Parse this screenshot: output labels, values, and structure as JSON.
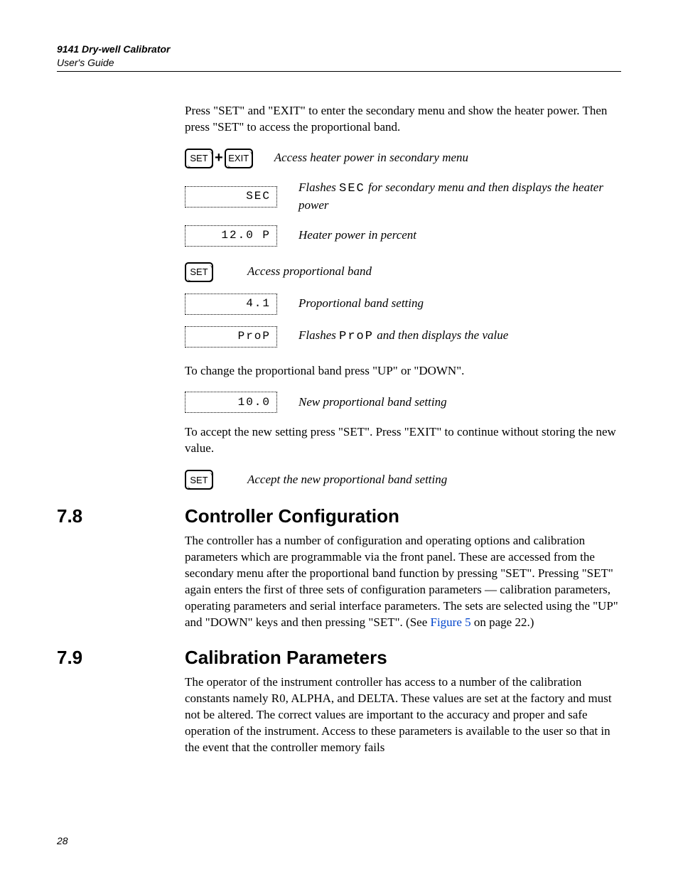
{
  "header": {
    "title": "9141 Dry-well Calibrator",
    "subtitle": "User's Guide"
  },
  "intro_para": "Press \"SET\" and \"EXIT\" to enter the secondary menu and show the heater power. Then press \"SET\" to access the proportional band.",
  "keys": {
    "set": "SET",
    "exit": "EXIT",
    "plus": "+"
  },
  "rows": {
    "r1": {
      "desc": "Access heater power in secondary menu"
    },
    "r2": {
      "disp": "SEC",
      "desc_pre": "Flashes ",
      "desc_code": "SEC",
      "desc_post": " for secondary menu and then displays the heater power"
    },
    "r3": {
      "disp": "12.0 P",
      "desc": "Heater power in percent"
    },
    "r4": {
      "desc": "Access proportional band"
    },
    "r5": {
      "disp": "4.1",
      "desc": "Proportional band setting"
    },
    "r6": {
      "disp": "ProP",
      "desc_pre": "Flashes ",
      "desc_code": "ProP",
      "desc_post": " and then displays the value"
    }
  },
  "mid_para": "To change the proportional band press \"UP\" or \"DOWN\".",
  "rows2": {
    "r7": {
      "disp": "10.0",
      "desc": "New proportional band setting"
    }
  },
  "accept_para": "To accept the new setting press \"SET\". Press \"EXIT\" to continue without storing the new value.",
  "rows3": {
    "r8": {
      "desc": "Accept the new proportional band setting"
    }
  },
  "section78": {
    "num": "7.8",
    "title": "Controller Configuration",
    "body_a": "The controller has a number of configuration and operating options and calibration parameters which are programmable via the front panel. These are accessed from the secondary menu after the proportional band function by pressing \"SET\". Pressing \"SET\" again enters the first of three sets of configuration parameters — calibration parameters, operating parameters and serial interface parameters. The sets are selected using the \"UP\" and \"DOWN\" keys and then pressing \"SET\". (See ",
    "fig_link": "Figure 5",
    "body_b": " on page 22.)"
  },
  "section79": {
    "num": "7.9",
    "title": "Calibration Parameters",
    "body": "The operator of the instrument controller has access to a number of the calibration constants namely R0, ALPHA, and DELTA. These values are set at the factory and must not be altered. The correct values are important to the accuracy and proper and safe operation of the instrument. Access to these parameters is available to the user so that in the event that the controller memory fails"
  },
  "page_number": "28"
}
